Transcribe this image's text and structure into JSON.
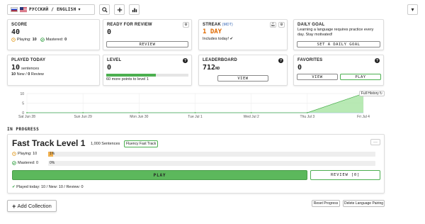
{
  "topbar": {
    "language_label": "РУССКИЙ / ENGLISH",
    "caret": "▾",
    "search_icon": "search-icon",
    "add_icon": "plus-icon",
    "stats_icon": "bar-chart-icon",
    "menu_caret": "▾"
  },
  "cards": {
    "score": {
      "title": "SCORE",
      "value": "40",
      "playing_label": "Playing:",
      "playing_value": "10",
      "mastered_label": "Mastered:",
      "mastered_value": "0"
    },
    "ready": {
      "title": "READY FOR REVIEW",
      "value": "0",
      "button": "REVIEW"
    },
    "streak": {
      "title": "STREAK",
      "tz": "(MDT)",
      "value": "1 DAY",
      "note": "Includes today! ✔"
    },
    "goal": {
      "title": "DAILY GOAL",
      "text": "Learning a language requires practice every day. Stay motivated!",
      "button": "SET A DAILY GOAL"
    },
    "played": {
      "title": "PLAYED TODAY",
      "value": "10",
      "unit": "sentences",
      "new_value": "10",
      "new_label": "New /",
      "review_value": "0",
      "review_label": "Review"
    },
    "level": {
      "title": "LEVEL",
      "value": "0",
      "progress": 0.6,
      "note": "60 more points to level 1"
    },
    "leaderboard": {
      "title": "LEADERBOARD",
      "value": "712",
      "suffix": "ND",
      "button": "VIEW"
    },
    "favorites": {
      "title": "FAVORITES",
      "value": "0",
      "view_button": "VIEW",
      "play_button": "PLAY"
    }
  },
  "chart_data": {
    "type": "area",
    "categories": [
      "Sat Jun 28",
      "Sun Jun 29",
      "Mon Jun 30",
      "Tue Jul 1",
      "Wed Jul 2",
      "Thu Jul 3",
      "Fri Jul 4"
    ],
    "values": [
      0,
      0,
      0,
      0,
      0,
      0,
      10
    ],
    "ylim": [
      0,
      10
    ],
    "yticks": [
      "10",
      "5",
      "0"
    ],
    "grid": true,
    "history_button": "Full History",
    "colors": {
      "fill": "#a6e3a1",
      "line": "#4caf50",
      "baseline": "#8fb9e0"
    }
  },
  "progress": {
    "section_label": "IN PROGRESS",
    "title": "Fast Track Level 1",
    "sentences": "1,000 Sentences",
    "badge": "Fluency Fast Track",
    "more": "···",
    "playing_label": "Playing: 10",
    "playing_pct": "1%",
    "playing_frac": 0.01,
    "mastered_label": "Mastered: 0",
    "mastered_pct": "0%",
    "play_button": "PLAY",
    "review_button": "REVIEW [0]",
    "played_line": "Played today: 10 / New: 10 / Review: 0"
  },
  "footer": {
    "add_collection": "Add Collection",
    "reset_progress": "Reset Progress",
    "delete_pairing": "Delete Language Pairing"
  }
}
